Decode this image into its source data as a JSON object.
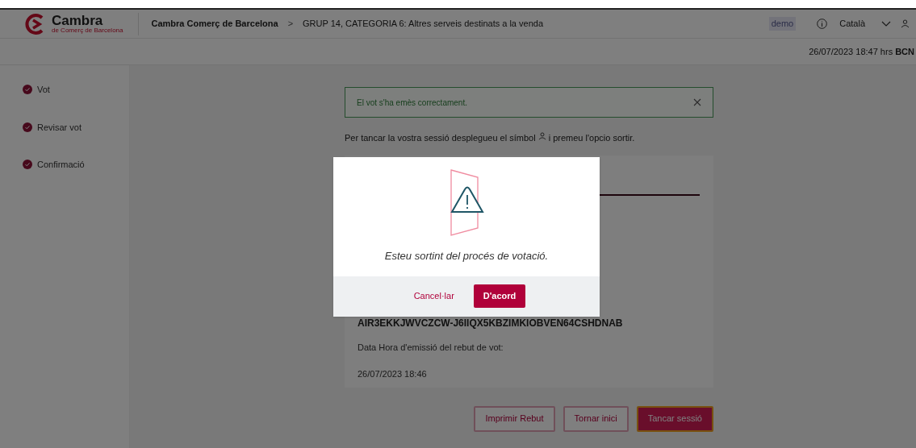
{
  "header": {
    "logo": {
      "name": "Cambra",
      "subtitle": "de Comerç de Barcelona"
    },
    "breadcrumb": [
      "Cambra Comerç de Barcelona",
      "GRUP 14, CATEGORIA 6: Altres serveis destinats a la venda"
    ],
    "separator": ">",
    "environment": "demo",
    "language": "Català"
  },
  "datetime": {
    "value": "26/07/2023 18:47 hrs",
    "zone": "BCN"
  },
  "steps": [
    {
      "label": "Vot",
      "done": true
    },
    {
      "label": "Revisar vot",
      "done": true
    },
    {
      "label": "Confirmació",
      "done": true
    }
  ],
  "alert": {
    "message": "El vot s'ha emès correctament."
  },
  "instructions": {
    "before": "Per tancar la vostra sessió desplegueu el símbol",
    "after": "i premeu l'opcio sortir."
  },
  "receipt": {
    "key": "AIR3EKKJWVCZCW-J6IIQX5KBZIMKIOBVEN64CSHDNAB",
    "date_label": "Data Hora d'emissió del rebut de vot:",
    "date": "26/07/2023 18:46"
  },
  "actions": [
    {
      "label": "Imprimir Rebut",
      "kind": "outline",
      "focused": false
    },
    {
      "label": "Tornar inici",
      "kind": "outline",
      "focused": false
    },
    {
      "label": "Tancar sessió",
      "kind": "primary",
      "focused": true
    }
  ],
  "dialog": {
    "message": "Esteu sortint del procés de votació.",
    "buttons": [
      {
        "label": "Cancel·lar",
        "kind": "link"
      },
      {
        "label": "D'acord",
        "kind": "primary"
      }
    ]
  }
}
